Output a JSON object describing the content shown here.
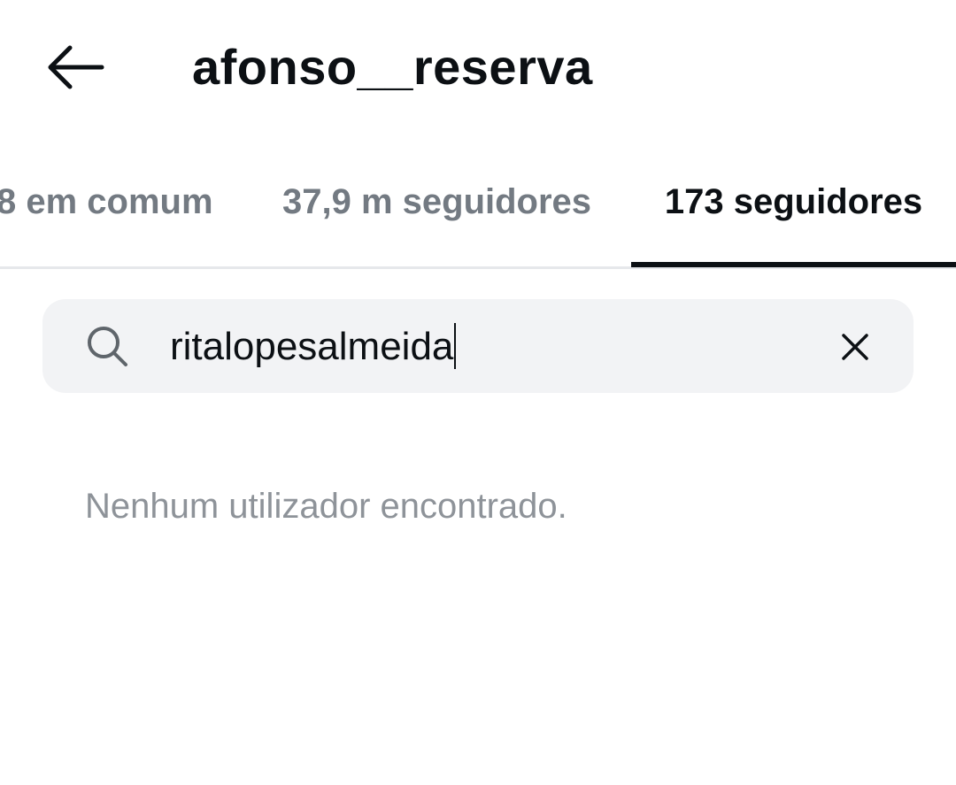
{
  "header": {
    "title": "afonso__reserva",
    "back_icon": "arrow-left-icon"
  },
  "tabs": [
    {
      "label": "8 em comum",
      "active": false
    },
    {
      "label": "37,9 m seguidores",
      "active": false
    },
    {
      "label": "173 seguidores",
      "active": true
    }
  ],
  "search": {
    "value": "ritalopesalmeida",
    "icon": "search-icon",
    "clear_icon": "close-icon"
  },
  "results": {
    "empty_message": "Nenhum utilizador encontrado."
  },
  "colors": {
    "text_primary": "#0c1014",
    "text_secondary": "#737a82",
    "search_bg": "#f2f3f5",
    "empty_text": "#8e9399"
  }
}
